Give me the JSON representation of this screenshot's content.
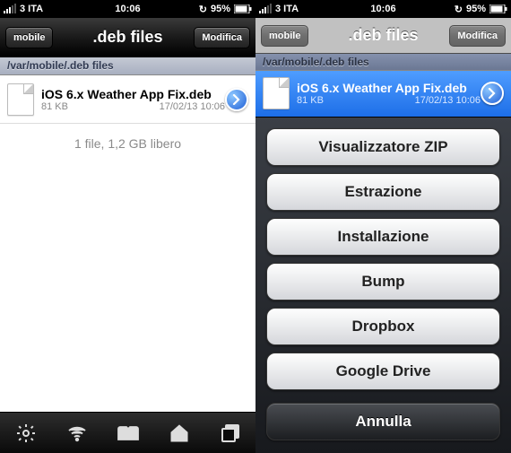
{
  "status": {
    "carrier": "3 ITA",
    "time": "10:06",
    "battery_pct": "95%"
  },
  "left": {
    "back_label": "mobile",
    "title": ".deb files",
    "edit_label": "Modifica",
    "path": "/var/mobile/.deb files",
    "file": {
      "name": "iOS 6.x Weather App Fix.deb",
      "size": "81 KB",
      "date": "17/02/13 10:06"
    },
    "summary": "1 file, 1,2 GB libero"
  },
  "right": {
    "back_label": "mobile",
    "title": ".deb files",
    "edit_label": "Modifica",
    "path": "/var/mobile/.deb files",
    "file": {
      "name": "iOS 6.x Weather App Fix.deb",
      "size": "81 KB",
      "date": "17/02/13 10:06"
    },
    "sheet": {
      "options": [
        "Visualizzatore ZIP",
        "Estrazione",
        "Installazione",
        "Bump",
        "Dropbox",
        "Google Drive"
      ],
      "cancel": "Annulla"
    }
  }
}
